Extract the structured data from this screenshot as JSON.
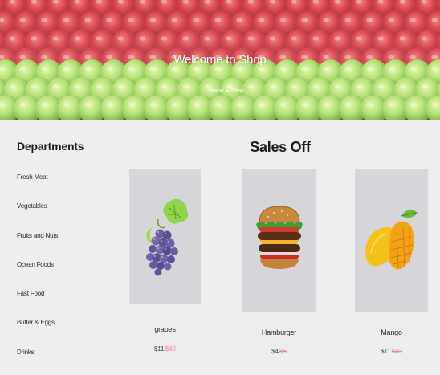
{
  "hero": {
    "title": "Welcome to Shop",
    "breadcrumb": {
      "home": "Home",
      "current": "Shop"
    }
  },
  "sidebar": {
    "title": "Departments",
    "items": [
      {
        "label": "Fresh Meat"
      },
      {
        "label": "Vegetables"
      },
      {
        "label": "Fruits and Nuts"
      },
      {
        "label": "Ocean Foods"
      },
      {
        "label": "Fast Food"
      },
      {
        "label": "Butter & Eggs"
      },
      {
        "label": "Drinks"
      }
    ]
  },
  "sales": {
    "title": "Sales Off",
    "products": [
      {
        "name": "grapes",
        "price": "$11",
        "old_price": "$42",
        "image": "grapes-image"
      },
      {
        "name": "Hamburger",
        "price": "$4",
        "old_price": "$6",
        "image": "hamburger-image"
      },
      {
        "name": "Mango",
        "price": "$11",
        "old_price": "$42",
        "image": "mango-image"
      }
    ]
  },
  "colors": {
    "accent": "#e28aa0",
    "card_image_bg": "#d6d6da",
    "content_bg": "#eeeeee"
  }
}
